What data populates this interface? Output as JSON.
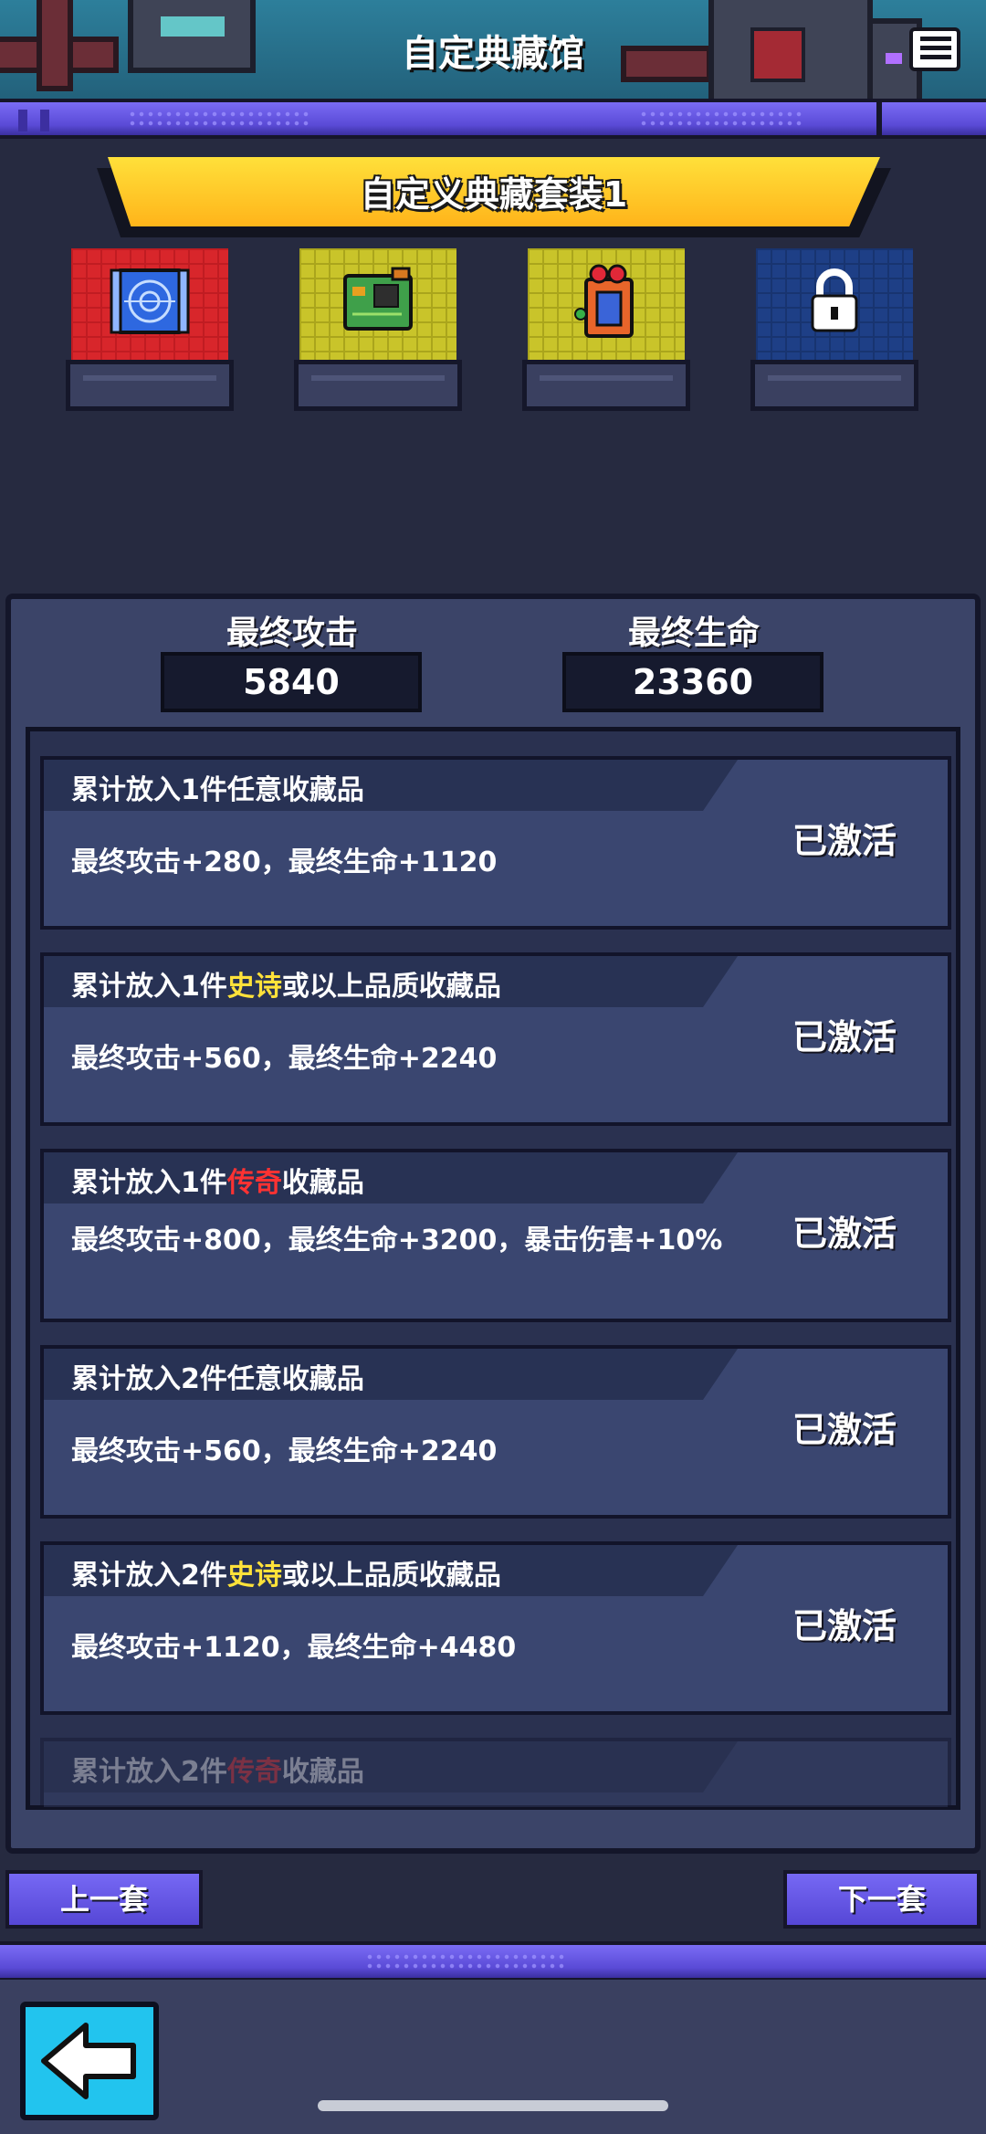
{
  "header": {
    "title": "自定典藏馆",
    "menu_icon": "list-menu-icon"
  },
  "set": {
    "title": "自定义典藏套装1"
  },
  "slots": [
    {
      "name": "blueprint-item-icon",
      "status": "filled",
      "color": "#d8262b"
    },
    {
      "name": "circuit-board-item-icon",
      "status": "filled",
      "color": "#c9c42a"
    },
    {
      "name": "gift-card-item-icon",
      "status": "filled",
      "color": "#c9c42a"
    },
    {
      "name": "lock-icon",
      "status": "locked",
      "color": "#1e3f86"
    }
  ],
  "stats": {
    "attack_label": "最终攻击",
    "attack_value": "5840",
    "hp_label": "最终生命",
    "hp_value": "23360"
  },
  "bonuses": [
    {
      "title_pre": "累计放入1件",
      "title_hl": "",
      "title_post": "任意收藏品",
      "desc": "最终攻击+280，最终生命+1120",
      "status": "已激活"
    },
    {
      "title_pre": "累计放入1件",
      "title_hl": "史诗",
      "title_post": "或以上品质收藏品",
      "desc": "最终攻击+560，最终生命+2240",
      "status": "已激活"
    },
    {
      "title_pre": "累计放入1件",
      "title_hl": "传奇",
      "title_post": "收藏品",
      "desc": "最终攻击+800，最终生命+3200，暴击伤害+10%",
      "status": "已激活"
    },
    {
      "title_pre": "累计放入2件",
      "title_hl": "",
      "title_post": "任意收藏品",
      "desc": "最终攻击+560，最终生命+2240",
      "status": "已激活"
    },
    {
      "title_pre": "累计放入2件",
      "title_hl": "史诗",
      "title_post": "或以上品质收藏品",
      "desc": "最终攻击+1120，最终生命+4480",
      "status": "已激活"
    },
    {
      "title_pre": "累计放入2件",
      "title_hl": "传奇",
      "title_post": "收藏品",
      "desc": "",
      "status": ""
    }
  ],
  "nav": {
    "prev": "上一套",
    "next": "下一套"
  },
  "colors": {
    "epic": "#ffe23a",
    "legend": "#ff3232",
    "accent": "#6a5cf0",
    "banner": "#ffc82a"
  }
}
